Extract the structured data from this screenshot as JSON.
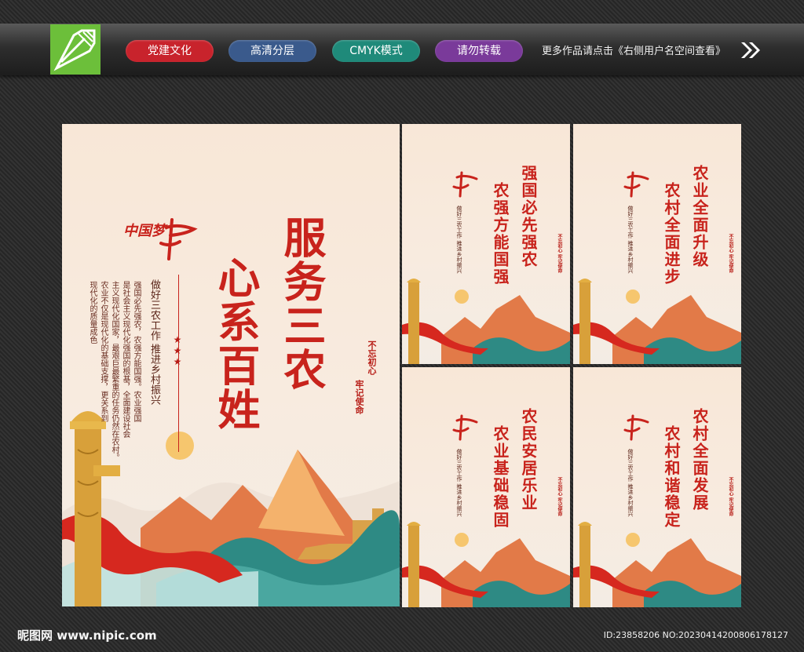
{
  "header": {
    "tags": [
      {
        "label": "党建文化",
        "color": "#c8232c"
      },
      {
        "label": "高清分层",
        "color": "#3a5a8c"
      },
      {
        "label": "CMYK模式",
        "color": "#1f8a7a"
      },
      {
        "label": "请勿转载",
        "color": "#7a3a9a"
      }
    ],
    "more_text": "更多作品请点击《右侧用户名空间查看》"
  },
  "colors": {
    "accent_red": "#c8231c",
    "poster_bg": "#f8e7d7",
    "logo_green": "#6cbf3a"
  },
  "main_poster": {
    "brand_small": "中国梦",
    "title_col1": "服务三农",
    "title_col2": "心系百姓",
    "subtitle": "做好三农工作 推进乡村振兴",
    "body_cols": [
      "强国必先强农，农强方能国强。农业强国",
      "是社会主义现代化强国的根基，全面建设社会",
      "主义现代化国家，最艰巨最繁重的任务仍然在农村。",
      "农业不仅是现代化的基础支撑，更关系到",
      "现代化的质量成色"
    ],
    "stamp1": "不忘初心",
    "stamp2": "牢记使命",
    "stars": "★★★"
  },
  "small_posters": [
    {
      "title_col1": "强国必先强农",
      "title_col2": "农强方能国强"
    },
    {
      "title_col1": "农业全面升级",
      "title_col2": "农村全面进步"
    },
    {
      "title_col1": "农民安居乐业",
      "title_col2": "农业基础稳固"
    },
    {
      "title_col1": "农村全面发展",
      "title_col2": "农村和谐稳定"
    }
  ],
  "small_common": {
    "subtitle": "做好三农工作 推进乡村振兴",
    "stamp": "不忘初心 牢记使命"
  },
  "footer": {
    "left": "昵图网 www.nipic.com",
    "right": "ID:23858206 NO:20230414200806178127"
  }
}
